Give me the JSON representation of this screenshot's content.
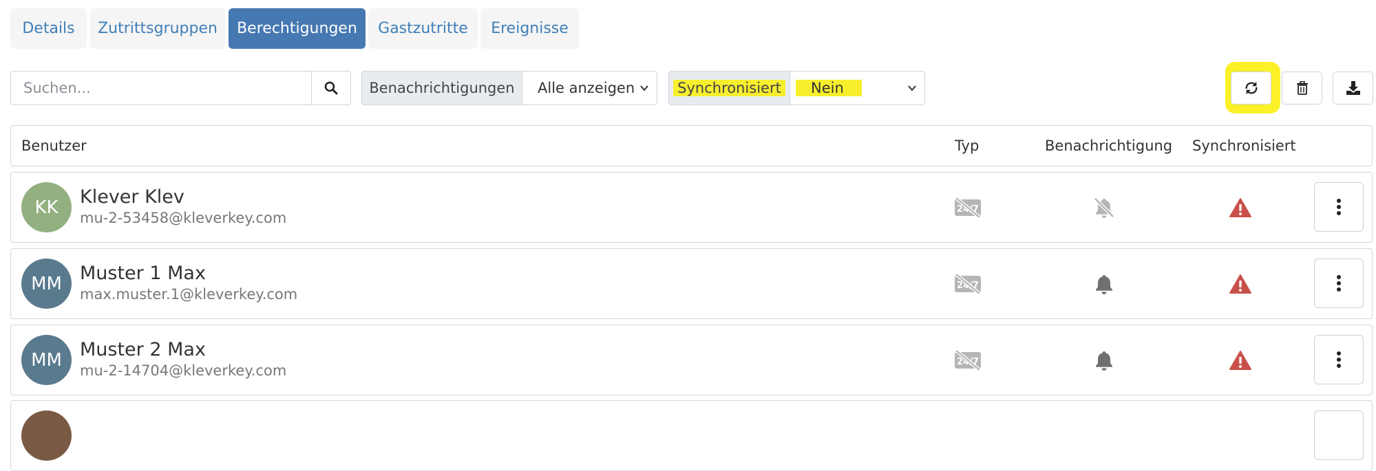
{
  "tabs": [
    {
      "label": "Details",
      "active": false
    },
    {
      "label": "Zutrittsgruppen",
      "active": false
    },
    {
      "label": "Berechtigungen",
      "active": true
    },
    {
      "label": "Gastzutritte",
      "active": false
    },
    {
      "label": "Ereignisse",
      "active": false
    }
  ],
  "filters": {
    "search_placeholder": "Suchen...",
    "notification_label": "Benachrichtigungen",
    "notification_value": "Alle anzeigen",
    "sync_label": "Synchronisiert",
    "sync_value": "Nein"
  },
  "actions": {
    "icons": [
      "sync-icon",
      "trash-icon",
      "download-icon"
    ]
  },
  "table": {
    "headers": {
      "user": "Benutzer",
      "type": "Typ",
      "notification": "Benachrichtigung",
      "synced": "Synchronisiert"
    },
    "rows": [
      {
        "initials": "KK",
        "name": "Klever Klev",
        "email": "mu-2-53458@kleverkey.com",
        "avatar_color": "#93b080",
        "type_icon": "no-24-7-icon",
        "notification": "bell-slash-icon",
        "synced": "warning-icon"
      },
      {
        "initials": "MM",
        "name": "Muster 1 Max",
        "email": "max.muster.1@kleverkey.com",
        "avatar_color": "#5a7a8e",
        "type_icon": "no-24-7-icon",
        "notification": "bell-icon",
        "synced": "warning-icon"
      },
      {
        "initials": "MM",
        "name": "Muster 2 Max",
        "email": "mu-2-14704@kleverkey.com",
        "avatar_color": "#5a7a8e",
        "type_icon": "no-24-7-icon",
        "notification": "bell-icon",
        "synced": "warning-icon"
      }
    ]
  },
  "colors": {
    "accent": "#4678b2",
    "link": "#3f7fb8",
    "highlight": "#f7ee2e",
    "warning": "#c9504a",
    "muted_icon": "#b5b5b5"
  }
}
